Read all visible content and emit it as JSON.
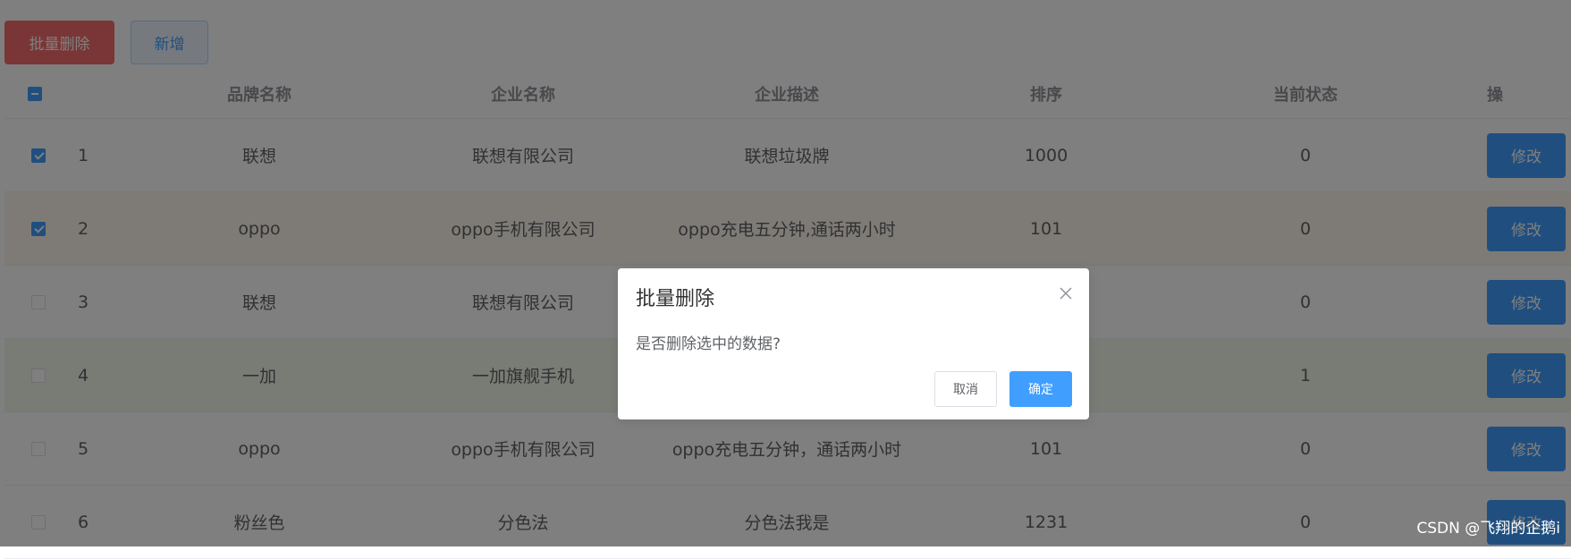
{
  "toolbar": {
    "batch_delete_label": "批量删除",
    "add_label": "新增"
  },
  "table": {
    "columns": [
      "品牌名称",
      "企业名称",
      "企业描述",
      "排序",
      "当前状态",
      "操"
    ],
    "rows": [
      {
        "index": "1",
        "brand": "联想",
        "company": "联想有限公司",
        "description": "联想垃圾牌",
        "order": "1000",
        "status": "0",
        "checked": true,
        "edit_label": "修改"
      },
      {
        "index": "2",
        "brand": "oppo",
        "company": "oppo手机有限公司",
        "description": "oppo充电五分钟,通话两小时",
        "order": "101",
        "status": "0",
        "checked": true,
        "edit_label": "修改"
      },
      {
        "index": "3",
        "brand": "联想",
        "company": "联想有限公司",
        "description": "",
        "order": "",
        "status": "0",
        "checked": false,
        "edit_label": "修改"
      },
      {
        "index": "4",
        "brand": "一加",
        "company": "一加旗舰手机",
        "description": "",
        "order": "",
        "status": "1",
        "checked": false,
        "edit_label": "修改"
      },
      {
        "index": "5",
        "brand": "oppo",
        "company": "oppo手机有限公司",
        "description": "oppo充电五分钟，通话两小时",
        "order": "101",
        "status": "0",
        "checked": false,
        "edit_label": "修改"
      },
      {
        "index": "6",
        "brand": "粉丝色",
        "company": "分色法",
        "description": "分色法我是",
        "order": "1231",
        "status": "0",
        "checked": false,
        "edit_label": "修改"
      }
    ]
  },
  "dialog": {
    "title": "批量删除",
    "message": "是否删除选中的数据?",
    "cancel_label": "取消",
    "confirm_label": "确定",
    "close_icon": "close-icon"
  },
  "watermark": "CSDN @飞翔的企鹅i",
  "colors": {
    "primary": "#409eff",
    "danger": "#f56c6c",
    "warning_row": "#fdf6ec",
    "success_row": "#f0f9eb",
    "overlay": "rgba(0,0,0,0.5)"
  }
}
